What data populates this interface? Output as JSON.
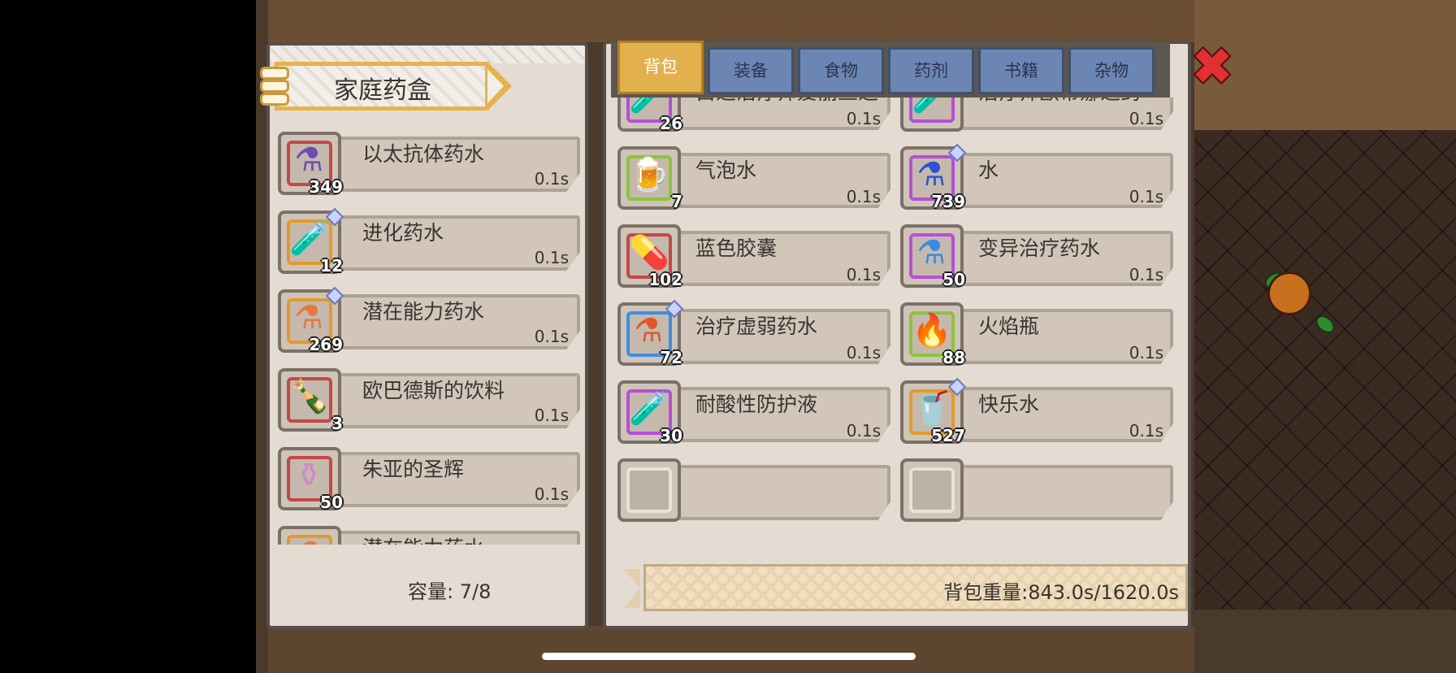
{
  "left_panel": {
    "title": "家庭药盒",
    "capacity": "容量: 7/8",
    "items": [
      {
        "name": "以太抗体药水",
        "time": "0.1s",
        "count": "349",
        "rarity": "#c44848",
        "icon": "purple-flask-icon",
        "tag": false
      },
      {
        "name": "进化药水",
        "time": "0.1s",
        "count": "12",
        "rarity": "#e39a2a",
        "icon": "purple-vial-icon",
        "tag": true
      },
      {
        "name": "潜在能力药水",
        "time": "0.1s",
        "count": "269",
        "rarity": "#e39a2a",
        "icon": "orange-flask-icon",
        "tag": true
      },
      {
        "name": "欧巴德斯的饮料",
        "time": "0.1s",
        "count": "3",
        "rarity": "#c44848",
        "icon": "cola-bottle-icon",
        "tag": false
      },
      {
        "name": "朱亚的圣辉",
        "time": "0.1s",
        "count": "50",
        "rarity": "#c44848",
        "icon": "holy-orb-flask-icon",
        "tag": false
      },
      {
        "name": "潜在能力药水",
        "time": "",
        "count": "",
        "rarity": "#e39a2a",
        "icon": "orange-flask-icon",
        "tag": false
      }
    ]
  },
  "tabs": [
    {
      "label": "背包",
      "active": true
    },
    {
      "label": "装备",
      "active": false
    },
    {
      "label": "食物",
      "active": false
    },
    {
      "label": "药剂",
      "active": false
    },
    {
      "label": "书籍",
      "active": false
    },
    {
      "label": "杂物",
      "active": false
    }
  ],
  "close_icon": "close-icon",
  "inventory": [
    {
      "name": "白之治疗师爱丽丝之",
      "time": "0.1s",
      "count": "26",
      "rarity": "#b64fd6",
      "icon": "white-vial-icon",
      "tag": false
    },
    {
      "name": "治疗师欧蒂娜之药",
      "time": "0.1s",
      "count": "",
      "rarity": "#b64fd6",
      "icon": "red-vial-icon",
      "tag": false
    },
    {
      "name": "气泡水",
      "time": "0.1s",
      "count": "7",
      "rarity": "#8cc43a",
      "icon": "beer-mug-icon",
      "tag": false
    },
    {
      "name": "水",
      "time": "0.1s",
      "count": "739",
      "rarity": "#b64fd6",
      "icon": "blue-flask-icon",
      "tag": true
    },
    {
      "name": "蓝色胶囊",
      "time": "0.1s",
      "count": "102",
      "rarity": "#c44848",
      "icon": "blue-capsule-icon",
      "tag": false
    },
    {
      "name": "变异治疗药水",
      "time": "0.1s",
      "count": "50",
      "rarity": "#b64fd6",
      "icon": "blue-potion-icon",
      "tag": false
    },
    {
      "name": "治疗虚弱药水",
      "time": "0.1s",
      "count": "72",
      "rarity": "#3e8ee0",
      "icon": "red-flask-icon",
      "tag": true
    },
    {
      "name": "火焰瓶",
      "time": "0.1s",
      "count": "88",
      "rarity": "#8cc43a",
      "icon": "fire-bottle-icon",
      "tag": false
    },
    {
      "name": "耐酸性防护液",
      "time": "0.1s",
      "count": "30",
      "rarity": "#b64fd6",
      "icon": "blue-vial-icon",
      "tag": false
    },
    {
      "name": "快乐水",
      "time": "0.1s",
      "count": "527",
      "rarity": "#e39a2a",
      "icon": "soda-bottle-icon",
      "tag": true
    },
    {
      "name": "",
      "time": "",
      "count": "",
      "rarity": "#e8e2da",
      "icon": "empty-slot-icon",
      "tag": false
    },
    {
      "name": "",
      "time": "",
      "count": "",
      "rarity": "#e8e2da",
      "icon": "empty-slot-icon",
      "tag": false
    }
  ],
  "weight": "背包重量:843.0s/1620.0s"
}
